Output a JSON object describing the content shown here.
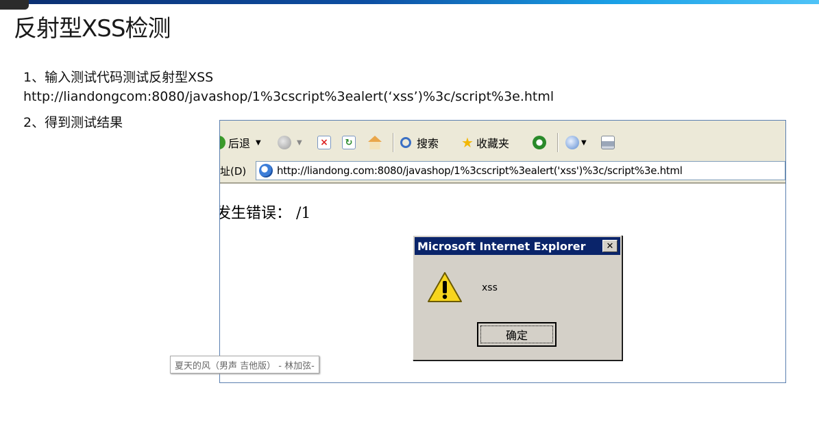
{
  "slide": {
    "title": "反射型XSS检测",
    "step1": "1、输入测试代码测试反射型XSS",
    "test_url": "http://liandongcom:8080/javashop/1%3cscript%3ealert(‘xss’)%3c/script%3e.html",
    "step2": "2、得到测试结果"
  },
  "browser": {
    "toolbar": {
      "back_label": "后退",
      "search_label": "搜索",
      "favorites_label": "收藏夹"
    },
    "address": {
      "label": "址(D)",
      "url": "http://liandong.com:8080/javashop/1%3cscript%3ealert('xss')%3c/script%3e.html"
    },
    "page": {
      "error_text": "发生错误：  /1"
    }
  },
  "dialog": {
    "title": "Microsoft Internet Explorer",
    "close_glyph": "✕",
    "message": "xss",
    "ok_label": "确定"
  },
  "tooltip": {
    "text": "夏天的风（男声 吉他版） - 林加弦-"
  },
  "colors": {
    "dialog_title_bg": "#0a246a",
    "toolbar_bg": "#ece9d8",
    "warning_yellow": "#f7d51e"
  }
}
